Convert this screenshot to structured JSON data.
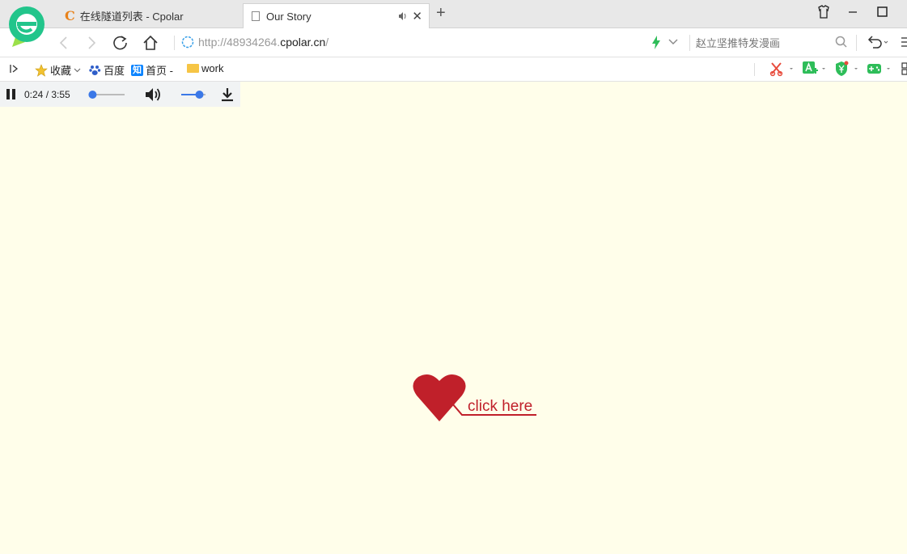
{
  "tabs": [
    {
      "title": "在线隧道列表 - Cpolar",
      "icon": "C"
    },
    {
      "title": "Our Story"
    }
  ],
  "address_bar": {
    "url_prefix": "http://48934264.",
    "url_host": "cpolar.cn",
    "url_suffix": "/"
  },
  "search": {
    "placeholder": "赵立坚推特发漫画"
  },
  "bookmarks": [
    {
      "label": "收藏"
    },
    {
      "label": "百度"
    },
    {
      "label": "首页 -",
      "badge": "知"
    },
    {
      "label": "work"
    }
  ],
  "audio": {
    "time": "0:24 / 3:55",
    "progress": 0.1,
    "volume": 0.75
  },
  "page": {
    "link_text": "click here",
    "accent": "#c0202a",
    "background": "#fffeea"
  }
}
